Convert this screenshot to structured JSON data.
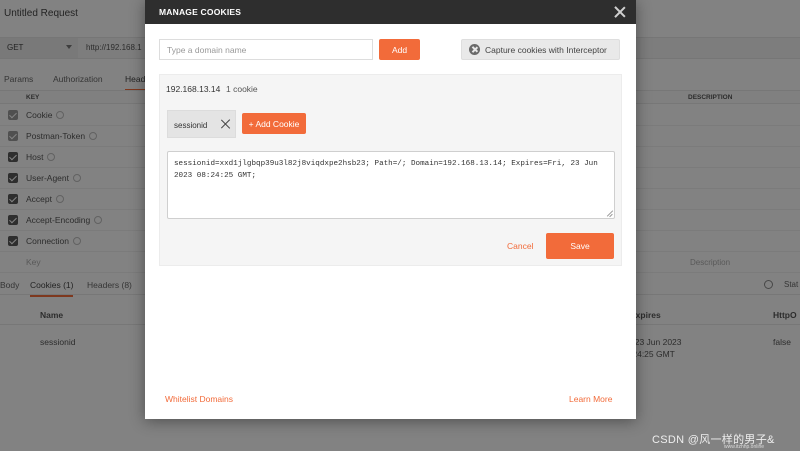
{
  "background": {
    "title": "Untitled Request",
    "method": "GET",
    "url": "http://192.168.1",
    "request_tabs": [
      "Params",
      "Authorization",
      "Head"
    ],
    "table_header": {
      "key": "KEY",
      "description": "DESCRIPTION"
    },
    "header_rows": [
      {
        "key": "Cookie",
        "checked": false
      },
      {
        "key": "Postman-Token",
        "checked": false
      },
      {
        "key": "Host",
        "checked": true
      },
      {
        "key": "User-Agent",
        "checked": true
      },
      {
        "key": "Accept",
        "checked": true
      },
      {
        "key": "Accept-Encoding",
        "checked": true
      },
      {
        "key": "Connection",
        "checked": true
      }
    ],
    "key_placeholder": "Key",
    "description_placeholder": "Description",
    "response_tabs": [
      "Body",
      "Cookies (1)",
      "Headers (8)"
    ],
    "status_label": "Stat",
    "cookie_table_headers": {
      "name": "Name",
      "expires": "Expires",
      "httponly": "HttpO"
    },
    "cookie_row": {
      "name": "sessionid",
      "expires_line1": ", 23 Jun 2023",
      "expires_line2": ":24:25 GMT",
      "httponly": "false"
    }
  },
  "modal": {
    "title": "MANAGE COOKIES",
    "domain_placeholder": "Type a domain name",
    "add_label": "Add",
    "interceptor_label": "Capture cookies with Interceptor",
    "domain": "192.168.13.14",
    "cookie_count": "1 cookie",
    "cookie_chip": "sessionid",
    "add_cookie_label": "+ Add Cookie",
    "cookie_value": "sessionid=xxd1jlgbqp39u3l82j8viqdxpe2hsb23; Path=/; Domain=192.168.13.14; Expires=Fri, 23 Jun 2023 08:24:25 GMT;",
    "cancel_label": "Cancel",
    "save_label": "Save",
    "whitelist_label": "Whitelist Domains",
    "learn_more_label": "Learn More"
  },
  "watermark": {
    "main": "CSDN @风一样的男子&",
    "sub": "www.itzhhp.online"
  },
  "colors": {
    "accent": "#f26b3a",
    "modal_header": "#2e2e2e",
    "overlay": "rgba(0,0,0,0.48)"
  }
}
